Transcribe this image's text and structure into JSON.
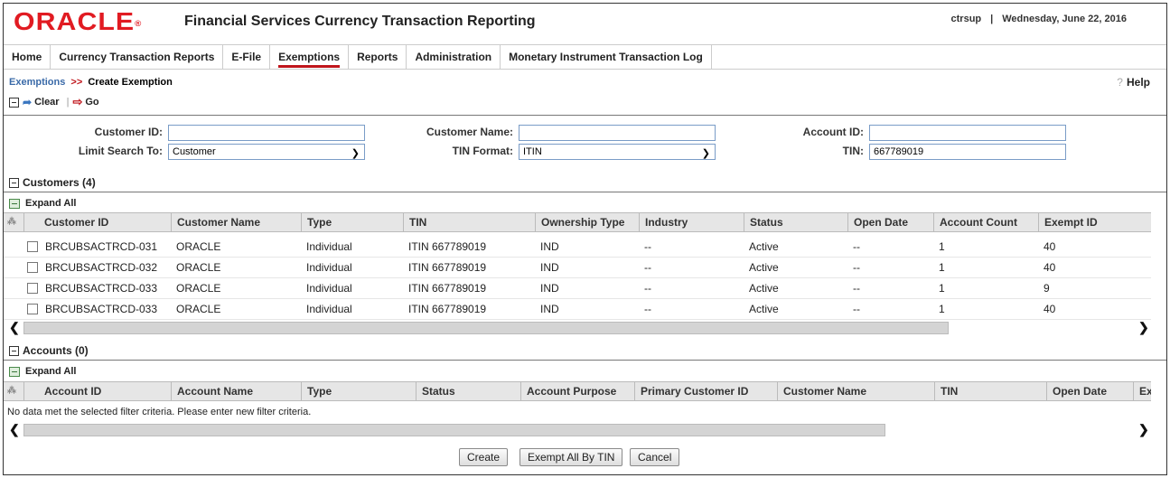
{
  "header": {
    "logo": "ORACLE",
    "title": "Financial Services Currency Transaction Reporting",
    "user": "ctrsup",
    "date": "Wednesday, June 22, 2016"
  },
  "nav": [
    {
      "label": "Home"
    },
    {
      "label": "Currency Transaction Reports"
    },
    {
      "label": "E-File"
    },
    {
      "label": "Exemptions",
      "active": true
    },
    {
      "label": "Reports"
    },
    {
      "label": "Administration"
    },
    {
      "label": "Monetary Instrument Transaction Log"
    }
  ],
  "breadcrumb": {
    "parent": "Exemptions",
    "separator": ">>",
    "current": "Create Exemption"
  },
  "help": "Help",
  "toolbar": {
    "clear": "Clear",
    "go": "Go"
  },
  "search": {
    "customer_id_label": "Customer ID:",
    "customer_id_value": "",
    "customer_name_label": "Customer Name:",
    "customer_name_value": "",
    "account_id_label": "Account ID:",
    "account_id_value": "",
    "limit_label": "Limit Search To:",
    "limit_value": "Customer",
    "tin_format_label": "TIN Format:",
    "tin_format_value": "ITIN",
    "tin_label": "TIN:",
    "tin_value": "667789019"
  },
  "customers": {
    "title": "Customers (4)",
    "expand_all": "Expand All",
    "columns": [
      "Customer ID",
      "Customer Name",
      "Type",
      "TIN",
      "Ownership Type",
      "Industry",
      "Status",
      "Open Date",
      "Account Count",
      "Exempt ID"
    ],
    "rows": [
      [
        "BRCUBSACTRCD-031",
        "ORACLE",
        "Individual",
        "ITIN 667789019",
        "IND",
        "--",
        "Active",
        "--",
        "1",
        "40"
      ],
      [
        "BRCUBSACTRCD-032",
        "ORACLE",
        "Individual",
        "ITIN 667789019",
        "IND",
        "--",
        "Active",
        "--",
        "1",
        "40"
      ],
      [
        "BRCUBSACTRCD-033",
        "ORACLE",
        "Individual",
        "ITIN 667789019",
        "IND",
        "--",
        "Active",
        "--",
        "1",
        "9"
      ],
      [
        "BRCUBSACTRCD-033",
        "ORACLE",
        "Individual",
        "ITIN 667789019",
        "IND",
        "--",
        "Active",
        "--",
        "1",
        "40"
      ]
    ]
  },
  "accounts": {
    "title": "Accounts (0)",
    "expand_all": "Expand All",
    "columns": [
      "Account ID",
      "Account Name",
      "Type",
      "Status",
      "Account Purpose",
      "Primary Customer ID",
      "Customer Name",
      "TIN",
      "Open Date",
      "Ex"
    ],
    "empty_message": "No data met the selected filter criteria. Please enter new filter criteria."
  },
  "buttons": {
    "create": "Create",
    "exempt_all": "Exempt All By TIN",
    "cancel": "Cancel"
  },
  "colors": {
    "brand_red": "#e11b22",
    "link_blue": "#3a6aa8",
    "active_tab": "#c0161c"
  }
}
